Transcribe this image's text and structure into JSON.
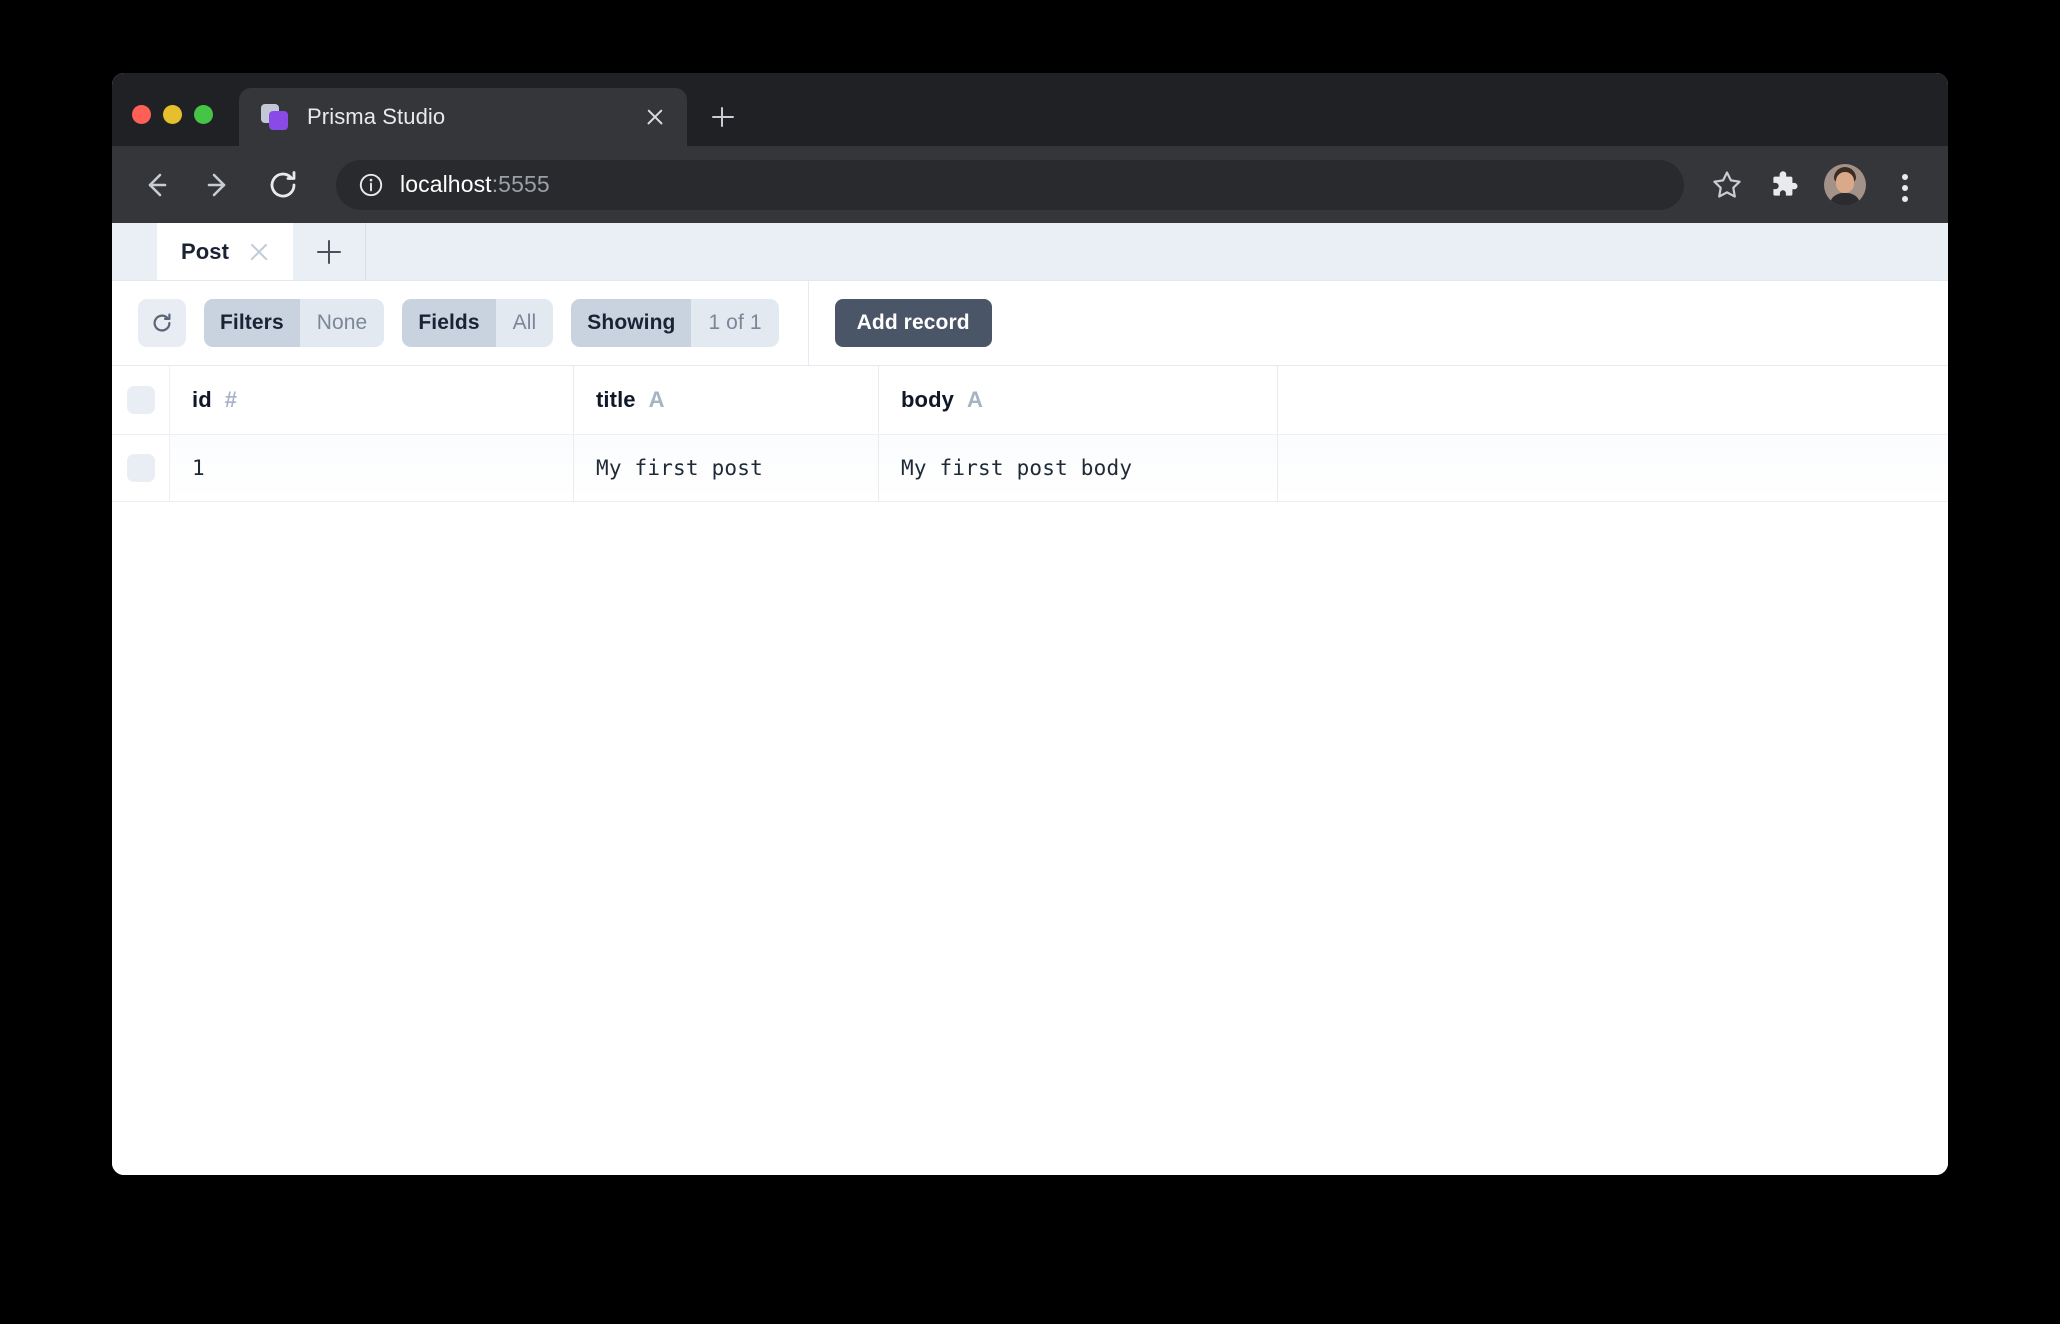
{
  "browser": {
    "tab": {
      "title": "Prisma Studio",
      "favicon_icon": "prisma-logo-icon",
      "close_icon": "close-icon"
    },
    "new_tab_icon": "plus-icon",
    "traffic_lights": {
      "close_color": "#ff5f57",
      "minimize_color": "#e5bf2c",
      "maximize_color": "#45c445"
    },
    "nav": {
      "back_icon": "arrow-left-icon",
      "forward_icon": "arrow-right-icon",
      "reload_icon": "reload-icon"
    },
    "omnibox": {
      "site_info_icon": "info-circle-icon",
      "url_host": "localhost",
      "url_port": ":5555"
    },
    "actions": {
      "bookmark_icon": "star-icon",
      "extensions_icon": "puzzle-piece-icon",
      "avatar_icon": "profile-avatar",
      "menu_icon": "three-dot-menu-icon"
    },
    "chrome_bg": "#35363a",
    "tabstrip_bg": "#202124"
  },
  "app": {
    "tabs": [
      {
        "label": "Post",
        "close_icon": "close-icon"
      }
    ],
    "add_tab_icon": "plus-icon",
    "toolbar": {
      "refresh_icon": "reload-icon",
      "filters": {
        "label": "Filters",
        "value": "None"
      },
      "fields": {
        "label": "Fields",
        "value": "All"
      },
      "showing": {
        "label": "Showing",
        "value": "1 of 1"
      },
      "add_record_label": "Add record",
      "add_record_color": "#4a5568"
    },
    "table": {
      "columns": [
        {
          "name": "id",
          "type_glyph": "#",
          "type": "number"
        },
        {
          "name": "title",
          "type_glyph": "A",
          "type": "string"
        },
        {
          "name": "body",
          "type_glyph": "A",
          "type": "string"
        }
      ],
      "rows": [
        {
          "id": "1",
          "title": "My first post",
          "body": "My first post body"
        }
      ]
    }
  }
}
